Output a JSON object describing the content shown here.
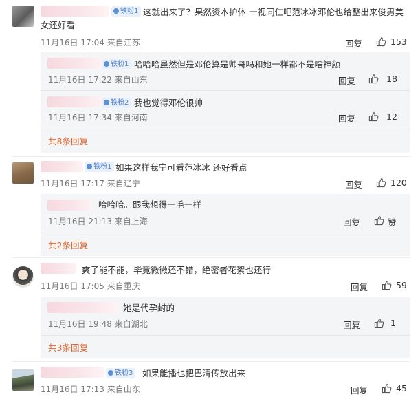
{
  "ui": {
    "reply_label": "回复"
  },
  "comments": [
    {
      "badge": "铁粉1",
      "text": "这就出来了？果然资本护体 一视同仁吧范冰冰邓伦也给整出来俊男美女还好看",
      "time": "11月16日 17:04 来自江苏",
      "likes": "153",
      "replies": [
        {
          "badge": "铁粉1",
          "text": "哈哈哈虽然但是邓伦算是帅哥吗和她一样都不是啥神颜",
          "time": "11月16日 17:22 来自山东",
          "likes": "18"
        },
        {
          "badge": "铁粉2",
          "text": "我也觉得邓伦很帅",
          "time": "11月16日 17:34 来自河南",
          "likes": "12"
        }
      ],
      "more": "共8条回复"
    },
    {
      "badge": "铁粉1",
      "text": "如果这样我宁可看范冰冰 还好看点",
      "time": "11月16日 17:17 来自辽宁",
      "likes": "120",
      "replies": [
        {
          "badge": "",
          "text": "哈哈哈。跟我想得一毛一样",
          "time": "11月16日 21:13 来自上海",
          "likes": "赞"
        }
      ],
      "more": "共2条回复"
    },
    {
      "badge": "",
      "text": "爽子能不能，毕竟微微还不错，绝密者花絮也还行",
      "time": "11月16日 17:05 来自重庆",
      "likes": "59",
      "replies": [
        {
          "badge": "",
          "text": "她是代孕封的",
          "time": "11月16日 19:48 来自湖北",
          "likes": "1"
        }
      ],
      "more": "共3条回复"
    },
    {
      "badge": "铁粉3",
      "text": "如果能播也把巴清传放出来",
      "time": "11月16日 17:13 来自山东",
      "likes": "45"
    }
  ]
}
